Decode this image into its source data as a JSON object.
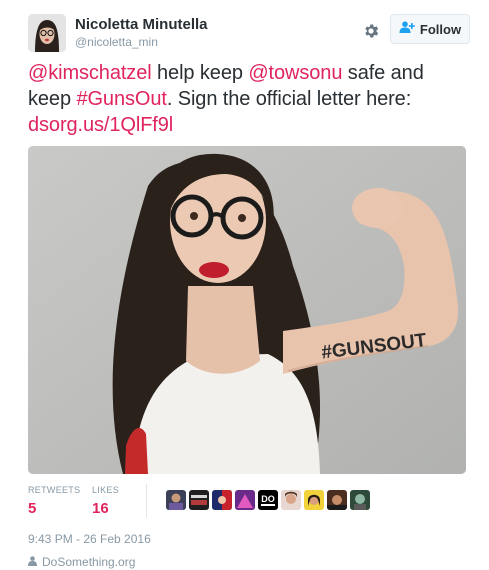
{
  "user": {
    "display_name": "Nicoletta Minutella",
    "handle": "@nicoletta_min"
  },
  "actions": {
    "follow_label": "Follow"
  },
  "tweet": {
    "mention_1": "@kimschatzel",
    "text_1": " help keep ",
    "mention_2": "@towsonu",
    "text_2": " safe and keep ",
    "hashtag": "#GunsOut",
    "text_3": ". Sign the official letter here: ",
    "link": "dsorg.us/1QlFf9l"
  },
  "photo": {
    "arm_text": "#GUNSOUT"
  },
  "stats": {
    "retweets_label": "RETWEETS",
    "retweets_value": "5",
    "likes_label": "LIKES",
    "likes_value": "16"
  },
  "timestamp": "9:43 PM - 26 Feb 2016",
  "location": "DoSomething.org",
  "colors": {
    "accent": "#e0245e",
    "text": "#292f33",
    "muted": "#8899a6",
    "border": "#e1e8ed"
  },
  "icons": {
    "settings": "gear-icon",
    "follow": "add-user-icon",
    "location": "person-icon"
  }
}
